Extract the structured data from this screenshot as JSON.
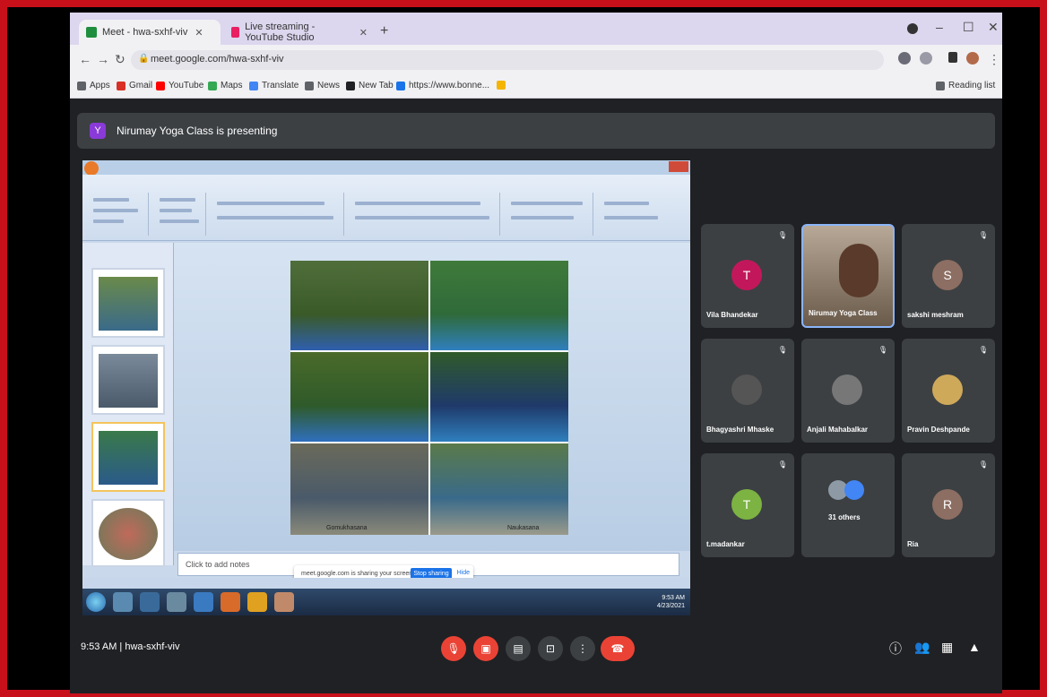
{
  "browser": {
    "tabs": [
      {
        "label": "Meet - hwa-sxhf-viv",
        "active": true,
        "color": "#1e8e3e"
      },
      {
        "label": "Live streaming - YouTube Studio",
        "active": false,
        "color": "#e91e63"
      }
    ],
    "new_tab": "+",
    "window_controls": {
      "minimize": "–",
      "maximize": "☐",
      "close": "✕"
    },
    "address": "meet.google.com/hwa-sxhf-viv",
    "bookmarks": [
      {
        "label": "Apps",
        "color": "#5f6368"
      },
      {
        "label": "Gmail",
        "color": "#d93025"
      },
      {
        "label": "YouTube",
        "color": "#ff0000"
      },
      {
        "label": "Maps",
        "color": "#34a853"
      },
      {
        "label": "Translate",
        "color": "#4285f4"
      },
      {
        "label": "News",
        "color": "#5f6368"
      },
      {
        "label": "New Tab",
        "color": "#202124"
      },
      {
        "label": "https://www.bonne...",
        "color": "#1a73e8"
      }
    ],
    "reading_list": "Reading list"
  },
  "meet": {
    "presenting_initial": "Y",
    "presenting_text": "Nirumay Yoga Class is presenting",
    "notes_placeholder": "Click to add notes",
    "sharing_text": "meet.google.com is sharing your screen.",
    "stop_sharing": "Stop sharing",
    "hide": "Hide",
    "slide_labels": [
      "Gomukhasana",
      "Naukasana"
    ],
    "taskbar_time": "9:53 AM",
    "taskbar_date": "4/23/2021",
    "participants": [
      {
        "name": "Vila Bhandekar",
        "initial": "T",
        "color": "#c2185b",
        "type": "avatar"
      },
      {
        "name": "Nirumay Yoga Class",
        "initial": "",
        "color": "#8a6a5a",
        "type": "video"
      },
      {
        "name": "sakshi meshram",
        "initial": "S",
        "color": "#8d6e63",
        "type": "avatar"
      },
      {
        "name": "Bhagyashri Mhaske",
        "initial": "",
        "color": "#555",
        "type": "photo"
      },
      {
        "name": "Anjali Mahabalkar",
        "initial": "",
        "color": "#777",
        "type": "photo"
      },
      {
        "name": "Pravin Deshpande",
        "initial": "",
        "color": "#cfa95a",
        "type": "photo"
      },
      {
        "name": "t.madankar",
        "initial": "T",
        "color": "#7cb342",
        "type": "avatar"
      },
      {
        "name": "31 others",
        "initial": "",
        "color": "#4285f4",
        "type": "others"
      },
      {
        "name": "Ria",
        "initial": "R",
        "color": "#8d6e63",
        "type": "avatar"
      }
    ],
    "meeting_time": "9:53 AM",
    "meeting_code": "hwa-sxhf-viv",
    "accent_red": "#ea4335"
  }
}
